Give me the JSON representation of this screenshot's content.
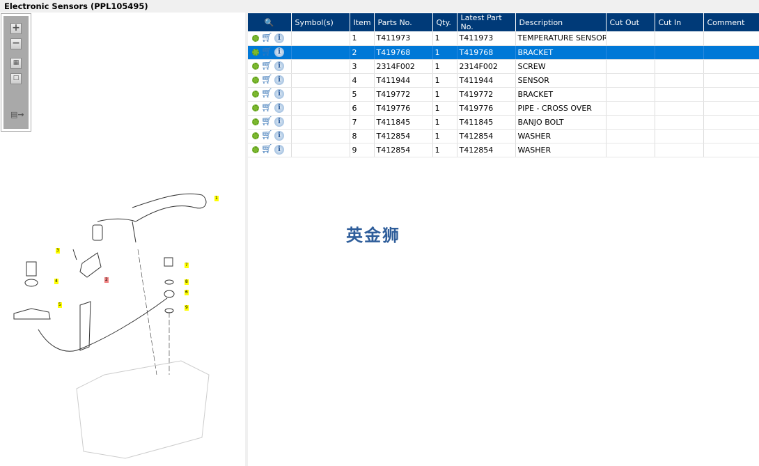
{
  "title": "Electronic Sensors (PPL105495)",
  "toolbar": {
    "zoom_in": "+",
    "zoom_out": "−"
  },
  "diagram": {
    "callouts": [
      {
        "label": "1",
        "highlight": false
      },
      {
        "label": "2",
        "highlight": true
      },
      {
        "label": "3",
        "highlight": false
      },
      {
        "label": "4",
        "highlight": false
      },
      {
        "label": "5",
        "highlight": false
      },
      {
        "label": "6",
        "highlight": false
      },
      {
        "label": "7",
        "highlight": false
      },
      {
        "label": "8",
        "highlight": false
      },
      {
        "label": "9",
        "highlight": false
      }
    ]
  },
  "watermark": "英金狮",
  "table": {
    "columns": [
      "Symbol(s)",
      "Item",
      "Parts No.",
      "Qty.",
      "Latest Part No.",
      "Description",
      "Cut Out",
      "Cut In",
      "Comment"
    ],
    "selected_row": 1,
    "rows": [
      {
        "symbols": "",
        "item": "1",
        "part": "T411973",
        "qty": "1",
        "latest": "T411973",
        "desc": "TEMPERATURE SENSOR",
        "cut_out": "",
        "cut_in": "",
        "comment": ""
      },
      {
        "symbols": "",
        "item": "2",
        "part": "T419768",
        "qty": "1",
        "latest": "T419768",
        "desc": "BRACKET",
        "cut_out": "",
        "cut_in": "",
        "comment": ""
      },
      {
        "symbols": "",
        "item": "3",
        "part": "2314F002",
        "qty": "1",
        "latest": "2314F002",
        "desc": "SCREW",
        "cut_out": "",
        "cut_in": "",
        "comment": ""
      },
      {
        "symbols": "",
        "item": "4",
        "part": "T411944",
        "qty": "1",
        "latest": "T411944",
        "desc": "SENSOR",
        "cut_out": "",
        "cut_in": "",
        "comment": ""
      },
      {
        "symbols": "",
        "item": "5",
        "part": "T419772",
        "qty": "1",
        "latest": "T419772",
        "desc": "BRACKET",
        "cut_out": "",
        "cut_in": "",
        "comment": ""
      },
      {
        "symbols": "",
        "item": "6",
        "part": "T419776",
        "qty": "1",
        "latest": "T419776",
        "desc": "PIPE - CROSS OVER",
        "cut_out": "",
        "cut_in": "",
        "comment": ""
      },
      {
        "symbols": "",
        "item": "7",
        "part": "T411845",
        "qty": "1",
        "latest": "T411845",
        "desc": "BANJO BOLT",
        "cut_out": "",
        "cut_in": "",
        "comment": ""
      },
      {
        "symbols": "",
        "item": "8",
        "part": "T412854",
        "qty": "1",
        "latest": "T412854",
        "desc": "WASHER",
        "cut_out": "",
        "cut_in": "",
        "comment": ""
      },
      {
        "symbols": "",
        "item": "9",
        "part": "T412854",
        "qty": "1",
        "latest": "T412854",
        "desc": "WASHER",
        "cut_out": "",
        "cut_in": "",
        "comment": ""
      }
    ]
  }
}
